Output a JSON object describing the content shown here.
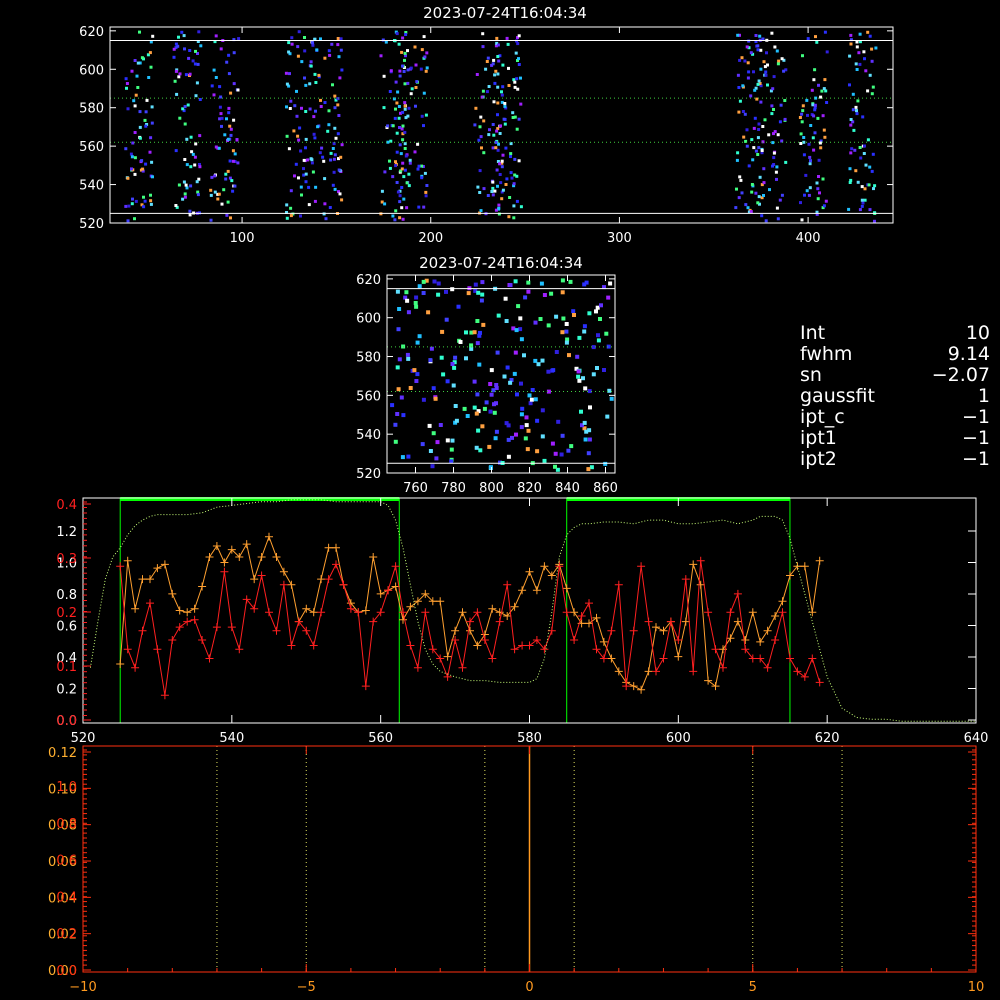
{
  "panel1": {
    "title": "2023-07-24T16:04:34",
    "xticks": [
      "100",
      "200",
      "300",
      "400"
    ],
    "yticks": [
      "520",
      "540",
      "560",
      "580",
      "600",
      "620"
    ]
  },
  "panel2": {
    "title": "2023-07-24T16:04:34",
    "xticks": [
      "760",
      "780",
      "800",
      "820",
      "840",
      "860"
    ],
    "yticks": [
      "520",
      "540",
      "560",
      "580",
      "600",
      "620"
    ]
  },
  "info": [
    {
      "key": "Int",
      "value": "10"
    },
    {
      "key": "fwhm",
      "value": "9.14"
    },
    {
      "key": "sn",
      "value": "−2.07"
    },
    {
      "key": "gaussfit",
      "value": "1"
    },
    {
      "key": "ipt_c",
      "value": "−1"
    },
    {
      "key": "ipt1",
      "value": "−1"
    },
    {
      "key": "ipt2",
      "value": "−1"
    }
  ],
  "panel3": {
    "xticks": [
      "520",
      "540",
      "560",
      "580",
      "600",
      "620",
      "640"
    ],
    "yticks_left_white": [
      "0.0",
      "0.2",
      "0.4",
      "0.6",
      "0.8",
      "1.0",
      "1.2"
    ],
    "yticks_left_red": [
      "0.0",
      "0.1",
      "0.2",
      "0.3",
      "0.4"
    ]
  },
  "panel4": {
    "xticks": [
      "−10",
      "−5",
      "0",
      "5",
      "10"
    ],
    "yticks_left_yellow": [
      "0.00",
      "0.02",
      "0.04",
      "0.06",
      "0.08",
      "0.10",
      "0.12"
    ],
    "yticks_left_red": [
      "0.0",
      "0.2",
      "0.4",
      "0.6",
      "0.8",
      "1.0"
    ]
  },
  "colors": {
    "axis": "#ffffff",
    "profile_orange": "#ffa030",
    "profile_red": "#ff2020",
    "envelope": "#c8ff78",
    "window_green": "#00ff00",
    "panel4_axis": "#ff3010",
    "panel4_line": "#ff9a20"
  },
  "chart_data": [
    {
      "type": "heatmap",
      "xlim": [
        30,
        445
      ],
      "ylim": [
        520,
        622
      ],
      "guide_lines_y": [
        525,
        562,
        585,
        615
      ],
      "bright_columns_x": [
        45,
        70,
        90,
        130,
        145,
        180,
        190,
        230,
        240,
        368,
        380,
        402,
        428
      ]
    },
    {
      "type": "heatmap",
      "xlim": [
        745,
        865
      ],
      "ylim": [
        520,
        622
      ],
      "guide_lines_y": [
        525,
        562,
        585,
        615
      ]
    },
    {
      "type": "line",
      "xlim": [
        520,
        640
      ],
      "ylim": [
        0,
        1.22
      ],
      "windows": [
        [
          525,
          562.5
        ],
        [
          585,
          615
        ]
      ],
      "series": [
        {
          "x": [
            525,
            526,
            527,
            528,
            529,
            530,
            531,
            532,
            533,
            534,
            535,
            536,
            537,
            538,
            539,
            540,
            541,
            542,
            543,
            544,
            545,
            546,
            547,
            548,
            549,
            550,
            551,
            552,
            553,
            554,
            555,
            556,
            557,
            558,
            559,
            560,
            561,
            562,
            563,
            564,
            565,
            566,
            567,
            568,
            569,
            570,
            571,
            572,
            573,
            574,
            575,
            576,
            577,
            578,
            579,
            580,
            581,
            582,
            583,
            584,
            585,
            586,
            587,
            588,
            589,
            590,
            591,
            592,
            593,
            594,
            595,
            596,
            597,
            598,
            599,
            600,
            601,
            602,
            603,
            604,
            605,
            606,
            607,
            608,
            609,
            610,
            611,
            612,
            613,
            614,
            615,
            616,
            617,
            618,
            619
          ],
          "values": [
            0.32,
            0.88,
            0.62,
            0.78,
            0.78,
            0.84,
            0.86,
            0.7,
            0.61,
            0.6,
            0.62,
            0.74,
            0.9,
            0.96,
            0.87,
            0.94,
            0.9,
            0.97,
            0.78,
            0.9,
            1.01,
            0.9,
            0.82,
            0.75,
            0.55,
            0.62,
            0.6,
            0.78,
            0.95,
            0.95,
            0.75,
            0.65,
            0.6,
            0.61,
            0.9,
            0.7,
            0.72,
            0.74,
            0.56,
            0.63,
            0.66,
            0.7,
            0.66,
            0.66,
            0.36,
            0.5,
            0.6,
            0.5,
            0.42,
            0.48,
            0.62,
            0.6,
            0.58,
            0.63,
            0.72,
            0.82,
            0.72,
            0.85,
            0.8,
            0.86,
            0.73,
            0.6,
            0.54,
            0.54,
            0.57,
            0.44,
            0.35,
            0.28,
            0.22,
            0.2,
            0.18,
            0.28,
            0.52,
            0.5,
            0.55,
            0.36,
            0.55,
            0.86,
            0.75,
            0.23,
            0.2,
            0.4,
            0.46,
            0.55,
            0.45,
            0.6,
            0.44,
            0.5,
            0.58,
            0.66,
            0.8,
            0.85,
            0.85,
            0.6,
            0.88
          ],
          "color": "orange"
        },
        {
          "x": [
            525,
            526,
            527,
            528,
            529,
            530,
            531,
            532,
            533,
            534,
            535,
            536,
            537,
            538,
            539,
            540,
            541,
            542,
            543,
            544,
            545,
            546,
            547,
            548,
            549,
            550,
            551,
            552,
            553,
            554,
            555,
            556,
            557,
            558,
            559,
            560,
            561,
            562,
            563,
            564,
            565,
            566,
            567,
            568,
            569,
            570,
            571,
            572,
            573,
            574,
            575,
            576,
            577,
            578,
            579,
            580,
            581,
            582,
            583,
            584,
            585,
            586,
            587,
            588,
            589,
            590,
            591,
            592,
            593,
            594,
            595,
            596,
            597,
            598,
            599,
            600,
            601,
            602,
            603,
            604,
            605,
            606,
            607,
            608,
            609,
            610,
            611,
            612,
            613,
            614,
            615,
            616,
            617,
            618,
            619
          ],
          "values": [
            0.85,
            0.4,
            0.3,
            0.5,
            0.65,
            0.4,
            0.15,
            0.45,
            0.52,
            0.55,
            0.56,
            0.45,
            0.35,
            0.52,
            0.82,
            0.52,
            0.4,
            0.67,
            0.62,
            0.8,
            0.6,
            0.5,
            0.75,
            0.42,
            0.55,
            0.5,
            0.42,
            0.6,
            0.78,
            0.86,
            0.75,
            0.62,
            0.6,
            0.2,
            0.55,
            0.6,
            0.72,
            0.85,
            0.6,
            0.42,
            0.3,
            0.6,
            0.4,
            0.35,
            0.25,
            0.45,
            0.3,
            0.55,
            0.6,
            0.45,
            0.35,
            0.55,
            0.75,
            0.4,
            0.42,
            0.42,
            0.45,
            0.4,
            0.5,
            0.85,
            0.6,
            0.45,
            0.58,
            0.65,
            0.4,
            0.35,
            0.5,
            0.75,
            0.2,
            0.5,
            0.85,
            0.55,
            0.28,
            0.35,
            0.55,
            0.45,
            0.78,
            0.28,
            0.88,
            0.6,
            0.4,
            0.3,
            0.6,
            0.7,
            0.4,
            0.35,
            0.35,
            0.3,
            0.45,
            0.6,
            0.35,
            0.28,
            0.25,
            0.35,
            0.22
          ],
          "color": "red"
        },
        {
          "x": [
            521,
            522,
            523,
            524,
            525,
            526,
            527,
            528,
            529,
            530,
            532,
            534,
            536,
            538,
            540,
            542,
            544,
            546,
            548,
            550,
            552,
            554,
            556,
            558,
            560,
            561,
            562,
            563,
            564,
            565,
            566,
            567,
            568,
            570,
            572,
            574,
            576,
            578,
            580,
            581,
            582,
            583,
            584,
            585,
            586,
            587,
            588,
            590,
            592,
            594,
            596,
            598,
            600,
            602,
            604,
            606,
            608,
            610,
            611,
            612,
            613,
            614,
            615,
            616,
            617,
            618,
            619,
            620,
            622,
            624,
            626,
            628,
            630,
            632,
            634,
            636,
            638,
            640
          ],
          "values": [
            0.3,
            0.55,
            0.78,
            0.9,
            0.95,
            1.02,
            1.07,
            1.1,
            1.12,
            1.13,
            1.13,
            1.13,
            1.14,
            1.17,
            1.18,
            1.19,
            1.2,
            1.2,
            1.21,
            1.21,
            1.21,
            1.2,
            1.2,
            1.2,
            1.2,
            1.18,
            1.1,
            0.95,
            0.75,
            0.55,
            0.4,
            0.32,
            0.28,
            0.25,
            0.23,
            0.23,
            0.22,
            0.22,
            0.22,
            0.24,
            0.35,
            0.6,
            0.9,
            1.02,
            1.06,
            1.08,
            1.08,
            1.09,
            1.09,
            1.08,
            1.1,
            1.1,
            1.08,
            1.08,
            1.09,
            1.1,
            1.08,
            1.1,
            1.12,
            1.12,
            1.12,
            1.1,
            1.0,
            0.85,
            0.7,
            0.55,
            0.4,
            0.25,
            0.08,
            0.03,
            0.02,
            0.02,
            0.01,
            0.01,
            0.01,
            0.01,
            0.01,
            0.01
          ],
          "color": "envelope"
        }
      ]
    },
    {
      "type": "line",
      "xlim": [
        -10,
        10
      ],
      "ylim": [
        0,
        0.12
      ],
      "vlines_x": [
        -7,
        -5,
        -1,
        0,
        1,
        5,
        7
      ]
    }
  ]
}
